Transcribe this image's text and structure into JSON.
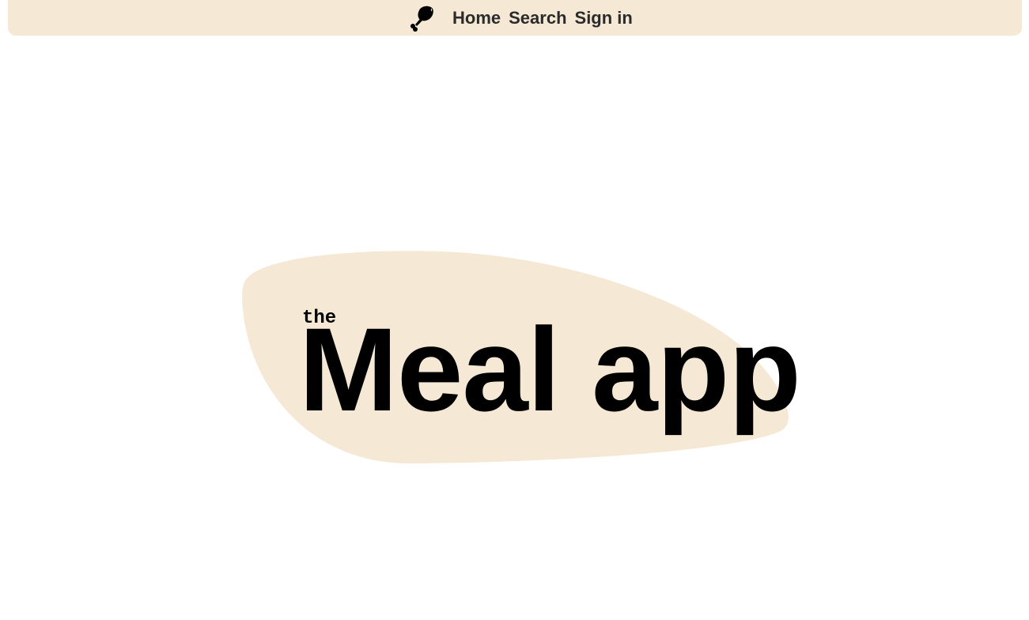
{
  "nav": {
    "logo_icon": "drumstick-icon",
    "links": [
      {
        "label": "Home"
      },
      {
        "label": "Search"
      },
      {
        "label": "Sign in"
      }
    ]
  },
  "hero": {
    "prefix": "the",
    "title": "Meal app"
  },
  "colors": {
    "accent_bg": "#f5e8d5",
    "text": "#000000",
    "nav_text": "#2b2b2b"
  }
}
